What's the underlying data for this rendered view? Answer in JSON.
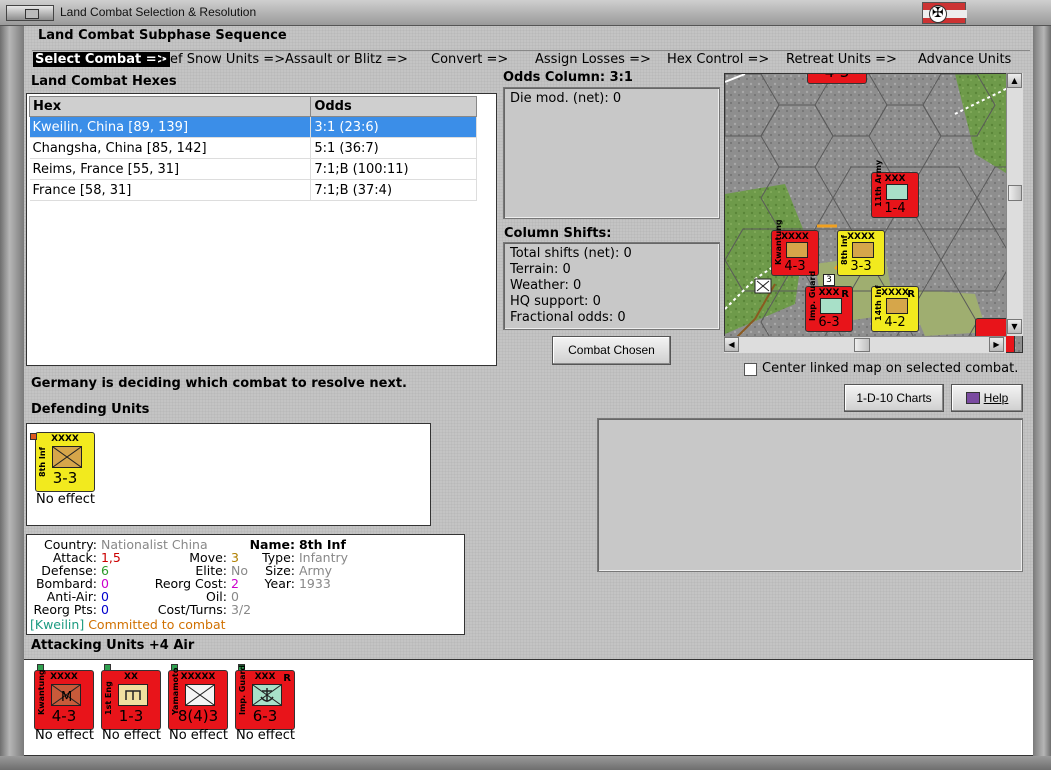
{
  "window": {
    "title": "Land Combat Selection & Resolution"
  },
  "subphase": {
    "title": "Land Combat Subphase Sequence",
    "steps": [
      "Select Combat =>",
      "Def Snow Units =>",
      "Assault or Blitz =>",
      "Convert =>",
      "Assign Losses =>",
      "Hex Control =>",
      "Retreat Units =>",
      "Advance Units"
    ]
  },
  "hexes": {
    "title": "Land Combat Hexes",
    "columns": [
      "Hex",
      "Odds"
    ],
    "rows": [
      {
        "hex": "Kweilin, China [89, 139]",
        "odds": "3:1 (23:6)"
      },
      {
        "hex": "Changsha, China [85, 142]",
        "odds": "5:1 (36:7)"
      },
      {
        "hex": "Reims, France [55, 31]",
        "odds": "7:1;B (100:11)"
      },
      {
        "hex": "France [58, 31]",
        "odds": "7:1;B (37:4)"
      }
    ]
  },
  "odds": {
    "title": "Odds Column: 3:1",
    "die_mod": "Die mod. (net): 0"
  },
  "shifts": {
    "title": "Column Shifts:",
    "lines": [
      "Total shifts (net): 0",
      "Terrain: 0",
      "Weather: 0",
      "HQ support: 0",
      "Fractional odds: 0"
    ]
  },
  "buttons": {
    "combat_chosen": "Combat Chosen",
    "charts": "1-D-10 Charts",
    "help": "Help"
  },
  "center_map_label": "Center linked map on selected combat.",
  "status_message": "Germany is deciding which combat to resolve next.",
  "defending": {
    "title": "Defending Units",
    "units": [
      {
        "size": "XXXX",
        "name": "8th Inf",
        "strength": "3-3",
        "effect": "No effect",
        "color": "yellow"
      }
    ]
  },
  "details": {
    "country_label": "Country:",
    "country": "Nationalist China",
    "attack_label": "Attack:",
    "attack": "1,5",
    "defense_label": "Defense:",
    "defense": "6",
    "bombard_label": "Bombard:",
    "bombard": "0",
    "antiair_label": "Anti-Air:",
    "antiair": "0",
    "reorg_pts_label": "Reorg Pts:",
    "reorg_pts": "0",
    "move_label": "Move:",
    "move": "3",
    "elite_label": "Elite:",
    "elite": "No",
    "reorg_cost_label": "Reorg Cost:",
    "reorg_cost": "2",
    "oil_label": "Oil:",
    "oil": "0",
    "cost_turns_label": "Cost/Turns:",
    "cost_turns": "3/2",
    "name_label": "Name:",
    "name": "8th Inf",
    "type_label": "Type:",
    "type": "Infantry",
    "size_label": "Size:",
    "size": "Army",
    "year_label": "Year:",
    "year": "1933",
    "location": "[Kweilin]",
    "committed": "Committed to combat"
  },
  "attacking": {
    "title": "Attacking Units +4 Air",
    "units": [
      {
        "size": "XXXX",
        "name": "Kwantung",
        "strength": "4-3",
        "effect": "No effect",
        "color": "red"
      },
      {
        "size": "XX",
        "name": "1st Eng",
        "strength": "1-3",
        "effect": "No effect",
        "color": "red"
      },
      {
        "size": "XXXXX",
        "name": "Yamamoto",
        "strength": "8(4)3",
        "effect": "No effect",
        "color": "red"
      },
      {
        "size": "XXX",
        "name": "Imp. Guard",
        "strength": "6-3",
        "effect": "No effect",
        "color": "red",
        "reg": "R"
      }
    ]
  },
  "map": {
    "counters": [
      {
        "size": "XXX",
        "name": "11th Army",
        "strength": "1-4",
        "color": "red"
      },
      {
        "size": "XXXX",
        "name": "Kwantung",
        "strength": "4-3",
        "color": "red"
      },
      {
        "size": "XXXX",
        "name": "8th Inf",
        "strength": "3-3",
        "color": "yellow"
      },
      {
        "size": "XXX",
        "name": "Imp. Guard",
        "strength": "6-3",
        "color": "red",
        "reg": "R"
      },
      {
        "size": "XXXX",
        "name": "14th Inf",
        "strength": "4-2",
        "color": "yellow",
        "reg": "R"
      }
    ],
    "top_strength": "4-3",
    "hq_number": "3"
  },
  "colors": {
    "selected_row": "#3b8ee8",
    "japan_red": "#e8141a",
    "china_yellow": "#f2ea1e",
    "attack_value": "#cc0000",
    "defense_value": "#2a9a2a",
    "bombard_value": "#cc00cc",
    "antiair_value": "#0000cc",
    "location_text": "#1a9a80",
    "committed_text": "#d07000"
  }
}
